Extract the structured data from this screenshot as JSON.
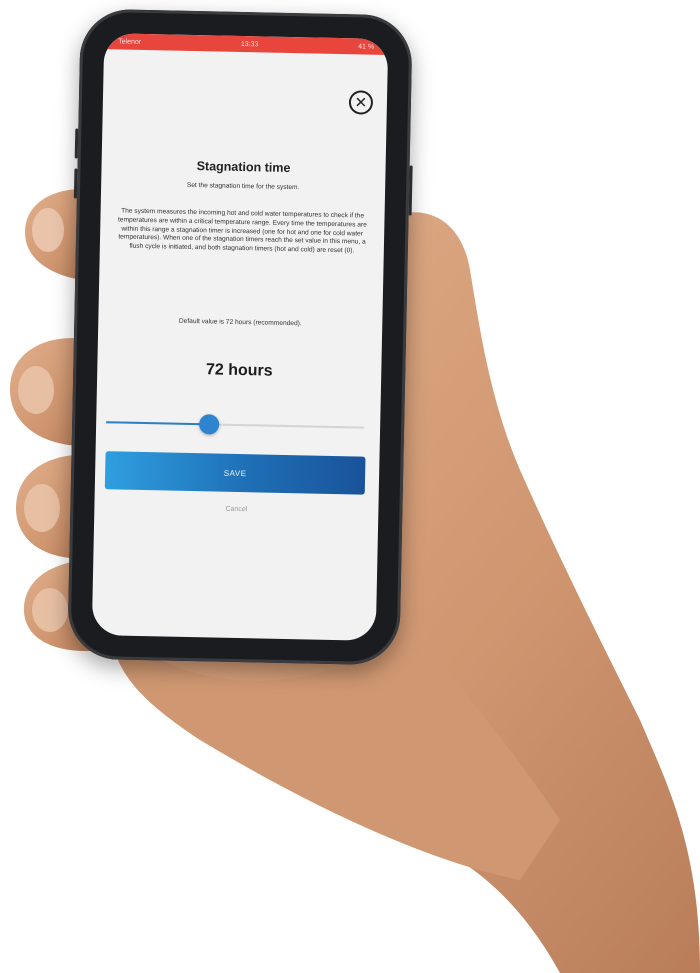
{
  "status_bar": {
    "carrier": "Telenor",
    "time": "13:33",
    "battery": "41 %"
  },
  "dialog": {
    "close_icon": "close-icon",
    "title": "Stagnation time",
    "subtitle": "Set the stagnation time for the system.",
    "description": "The system measures the incoming hot and cold water temperatures to check if the temperatures are within a critical temperature range. Every time the temperatures are within this range a stagnation timer is increased (one for hot and one for cold water temperatures). When one of the stagnation timers reach the set value in this menu, a flush cycle is initiated, and both stagnation timers (hot and cold) are reset (0).",
    "default_note": "Default value is 72 hours (recommended).",
    "value_label": "72 hours",
    "slider_fraction": 0.4,
    "save_label": "SAVE",
    "cancel_label": "Cancel"
  },
  "colors": {
    "status_bar": "#e8463c",
    "accent": "#2f84cf",
    "button_gradient_start": "#2f9fe0",
    "button_gradient_end": "#19539a"
  }
}
